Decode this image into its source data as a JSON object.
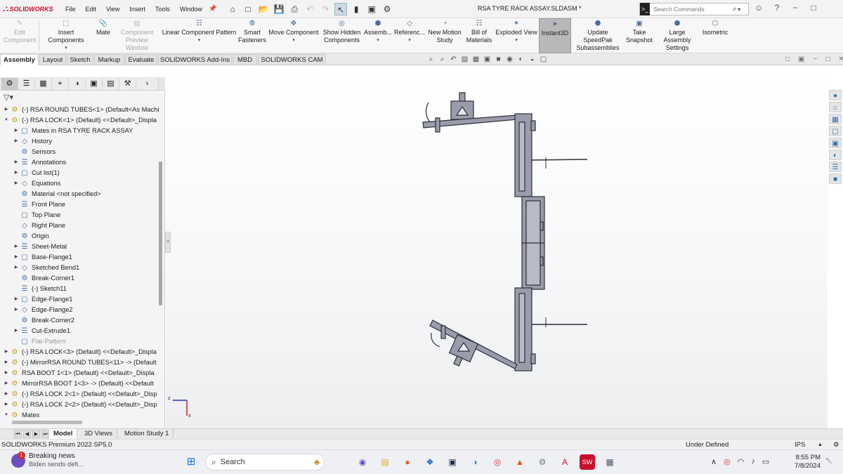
{
  "app": {
    "brand": "SOLIDWORKS",
    "document_title": "RSA TYRE RACK ASSAY.SLDASM *"
  },
  "menu": [
    "File",
    "Edit",
    "View",
    "Insert",
    "Tools",
    "Window"
  ],
  "search": {
    "placeholder": "Search Commands"
  },
  "commands": [
    {
      "label1": "Edit",
      "label2": "Component",
      "disabled": true
    },
    {
      "label1": "Insert Components",
      "label2": "",
      "disabled": false
    },
    {
      "label1": "Mate",
      "label2": "",
      "disabled": false
    },
    {
      "label1": "Component",
      "label2": "Preview Window",
      "disabled": true
    },
    {
      "label1": "Linear Component Pattern",
      "label2": "",
      "disabled": false
    },
    {
      "label1": "Smart",
      "label2": "Fasteners",
      "disabled": false
    },
    {
      "label1": "Move Component",
      "label2": "",
      "disabled": false
    },
    {
      "label1": "Show Hidden",
      "label2": "Components",
      "disabled": false
    },
    {
      "label1": "Assemb...",
      "label2": "",
      "disabled": false
    },
    {
      "label1": "Referenc...",
      "label2": "",
      "disabled": false
    },
    {
      "label1": "New Motion",
      "label2": "Study",
      "disabled": false
    },
    {
      "label1": "Bill of",
      "label2": "Materials",
      "disabled": false
    },
    {
      "label1": "Exploded View",
      "label2": "",
      "disabled": false
    },
    {
      "label1": "Instant3D",
      "label2": "",
      "disabled": false
    },
    {
      "label1": "Update SpeedPak",
      "label2": "Subassemblies",
      "disabled": false
    },
    {
      "label1": "Take",
      "label2": "Snapshot",
      "disabled": false
    },
    {
      "label1": "Large Assembly",
      "label2": "Settings",
      "disabled": false
    },
    {
      "label1": "Isometric",
      "label2": "",
      "disabled": false
    }
  ],
  "command_tabs": [
    "Assembly",
    "Layout",
    "Sketch",
    "Markup",
    "Evaluate",
    "SOLIDWORKS Add-Ins",
    "MBD",
    "SOLIDWORKS CAM"
  ],
  "tree": [
    {
      "label": "(-) RSA ROUND TUBES<1> (Default<As Machi",
      "level": 0,
      "caret": "right"
    },
    {
      "label": "(-) RSA LOCK<1> (Default) <<Default>_Displa",
      "level": 0,
      "caret": "down"
    },
    {
      "label": "Mates in RSA TYRE RACK ASSAY",
      "level": 1,
      "caret": "right"
    },
    {
      "label": "History",
      "level": 1,
      "caret": "right"
    },
    {
      "label": "Sensors",
      "level": 1,
      "caret": ""
    },
    {
      "label": "Annotations",
      "level": 1,
      "caret": "right"
    },
    {
      "label": "Cut list(1)",
      "level": 1,
      "caret": "right"
    },
    {
      "label": "Equations",
      "level": 1,
      "caret": "right"
    },
    {
      "label": "Material <not specified>",
      "level": 1,
      "caret": ""
    },
    {
      "label": "Front Plane",
      "level": 1,
      "caret": ""
    },
    {
      "label": "Top Plane",
      "level": 1,
      "caret": ""
    },
    {
      "label": "Right Plane",
      "level": 1,
      "caret": ""
    },
    {
      "label": "Origin",
      "level": 1,
      "caret": ""
    },
    {
      "label": "Sheet-Metal",
      "level": 1,
      "caret": "right"
    },
    {
      "label": "Base-Flange1",
      "level": 1,
      "caret": "right"
    },
    {
      "label": "Sketched Bend1",
      "level": 1,
      "caret": "right"
    },
    {
      "label": "Break-Corner1",
      "level": 1,
      "caret": ""
    },
    {
      "label": "(-) Sketch11",
      "level": 1,
      "caret": ""
    },
    {
      "label": "Edge-Flange1",
      "level": 1,
      "caret": "right"
    },
    {
      "label": "Edge-Flange2",
      "level": 1,
      "caret": "right"
    },
    {
      "label": "Break-Corner2",
      "level": 1,
      "caret": ""
    },
    {
      "label": "Cut-Extrude1",
      "level": 1,
      "caret": "right"
    },
    {
      "label": "Flat-Pattern",
      "level": 1,
      "caret": "",
      "gray": true
    },
    {
      "label": "(-) RSA LOCK<3> (Default) <<Default>_Displa",
      "level": 0,
      "caret": "right"
    },
    {
      "label": "(-) MirrorRSA ROUND TUBES<11> -> (Default",
      "level": 0,
      "caret": "right"
    },
    {
      "label": "RSA BOOT 1<1> (Default) <<Default>_Displa",
      "level": 0,
      "caret": "right"
    },
    {
      "label": "MirrorRSA BOOT 1<3> -> (Default) <<Default",
      "level": 0,
      "caret": "right"
    },
    {
      "label": "(-) RSA LOCK 2<1> (Default) <<Default>_Disp",
      "level": 0,
      "caret": "right"
    },
    {
      "label": "(-) RSA LOCK 2<2> (Default) <<Default>_Disp",
      "level": 0,
      "caret": "right"
    },
    {
      "label": "Mates",
      "level": 0,
      "caret": "down"
    }
  ],
  "bottom_tabs": [
    "Model",
    "3D Views",
    "Motion Study 1"
  ],
  "status": {
    "product": "SOLIDWORKS Premium 2022 SP5.0",
    "state": "Under Defined",
    "units": "IPS"
  },
  "taskbar": {
    "news_title": "Breaking news",
    "news_sub": "Biden sends defi...",
    "badge": "1",
    "search_label": "Search",
    "time": "8:55 PM",
    "date": "7/8/2024"
  },
  "colors": {
    "brand_red": "#c8102e",
    "model_fill": "#9a9cab",
    "model_stroke": "#2f2f3a",
    "active_tab": "#ffffff"
  }
}
